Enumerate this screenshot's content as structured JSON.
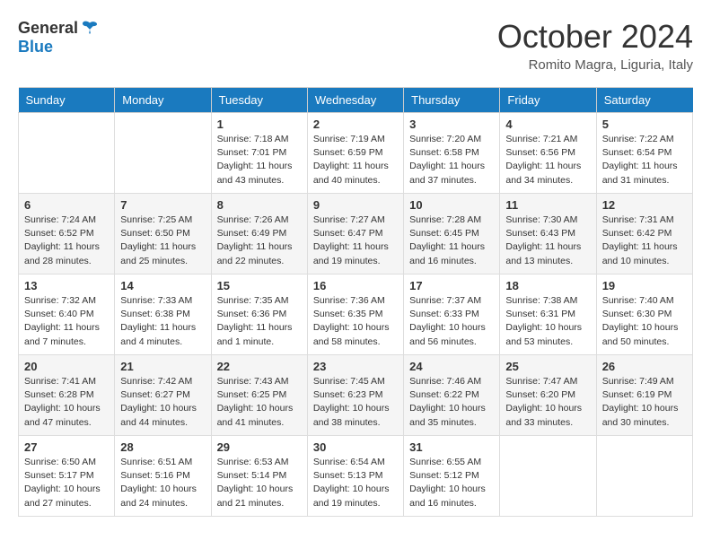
{
  "header": {
    "logo_general": "General",
    "logo_blue": "Blue",
    "month": "October 2024",
    "location": "Romito Magra, Liguria, Italy"
  },
  "days_of_week": [
    "Sunday",
    "Monday",
    "Tuesday",
    "Wednesday",
    "Thursday",
    "Friday",
    "Saturday"
  ],
  "weeks": [
    [
      {
        "day": "",
        "details": ""
      },
      {
        "day": "",
        "details": ""
      },
      {
        "day": "1",
        "details": "Sunrise: 7:18 AM\nSunset: 7:01 PM\nDaylight: 11 hours and 43 minutes."
      },
      {
        "day": "2",
        "details": "Sunrise: 7:19 AM\nSunset: 6:59 PM\nDaylight: 11 hours and 40 minutes."
      },
      {
        "day": "3",
        "details": "Sunrise: 7:20 AM\nSunset: 6:58 PM\nDaylight: 11 hours and 37 minutes."
      },
      {
        "day": "4",
        "details": "Sunrise: 7:21 AM\nSunset: 6:56 PM\nDaylight: 11 hours and 34 minutes."
      },
      {
        "day": "5",
        "details": "Sunrise: 7:22 AM\nSunset: 6:54 PM\nDaylight: 11 hours and 31 minutes."
      }
    ],
    [
      {
        "day": "6",
        "details": "Sunrise: 7:24 AM\nSunset: 6:52 PM\nDaylight: 11 hours and 28 minutes."
      },
      {
        "day": "7",
        "details": "Sunrise: 7:25 AM\nSunset: 6:50 PM\nDaylight: 11 hours and 25 minutes."
      },
      {
        "day": "8",
        "details": "Sunrise: 7:26 AM\nSunset: 6:49 PM\nDaylight: 11 hours and 22 minutes."
      },
      {
        "day": "9",
        "details": "Sunrise: 7:27 AM\nSunset: 6:47 PM\nDaylight: 11 hours and 19 minutes."
      },
      {
        "day": "10",
        "details": "Sunrise: 7:28 AM\nSunset: 6:45 PM\nDaylight: 11 hours and 16 minutes."
      },
      {
        "day": "11",
        "details": "Sunrise: 7:30 AM\nSunset: 6:43 PM\nDaylight: 11 hours and 13 minutes."
      },
      {
        "day": "12",
        "details": "Sunrise: 7:31 AM\nSunset: 6:42 PM\nDaylight: 11 hours and 10 minutes."
      }
    ],
    [
      {
        "day": "13",
        "details": "Sunrise: 7:32 AM\nSunset: 6:40 PM\nDaylight: 11 hours and 7 minutes."
      },
      {
        "day": "14",
        "details": "Sunrise: 7:33 AM\nSunset: 6:38 PM\nDaylight: 11 hours and 4 minutes."
      },
      {
        "day": "15",
        "details": "Sunrise: 7:35 AM\nSunset: 6:36 PM\nDaylight: 11 hours and 1 minute."
      },
      {
        "day": "16",
        "details": "Sunrise: 7:36 AM\nSunset: 6:35 PM\nDaylight: 10 hours and 58 minutes."
      },
      {
        "day": "17",
        "details": "Sunrise: 7:37 AM\nSunset: 6:33 PM\nDaylight: 10 hours and 56 minutes."
      },
      {
        "day": "18",
        "details": "Sunrise: 7:38 AM\nSunset: 6:31 PM\nDaylight: 10 hours and 53 minutes."
      },
      {
        "day": "19",
        "details": "Sunrise: 7:40 AM\nSunset: 6:30 PM\nDaylight: 10 hours and 50 minutes."
      }
    ],
    [
      {
        "day": "20",
        "details": "Sunrise: 7:41 AM\nSunset: 6:28 PM\nDaylight: 10 hours and 47 minutes."
      },
      {
        "day": "21",
        "details": "Sunrise: 7:42 AM\nSunset: 6:27 PM\nDaylight: 10 hours and 44 minutes."
      },
      {
        "day": "22",
        "details": "Sunrise: 7:43 AM\nSunset: 6:25 PM\nDaylight: 10 hours and 41 minutes."
      },
      {
        "day": "23",
        "details": "Sunrise: 7:45 AM\nSunset: 6:23 PM\nDaylight: 10 hours and 38 minutes."
      },
      {
        "day": "24",
        "details": "Sunrise: 7:46 AM\nSunset: 6:22 PM\nDaylight: 10 hours and 35 minutes."
      },
      {
        "day": "25",
        "details": "Sunrise: 7:47 AM\nSunset: 6:20 PM\nDaylight: 10 hours and 33 minutes."
      },
      {
        "day": "26",
        "details": "Sunrise: 7:49 AM\nSunset: 6:19 PM\nDaylight: 10 hours and 30 minutes."
      }
    ],
    [
      {
        "day": "27",
        "details": "Sunrise: 6:50 AM\nSunset: 5:17 PM\nDaylight: 10 hours and 27 minutes."
      },
      {
        "day": "28",
        "details": "Sunrise: 6:51 AM\nSunset: 5:16 PM\nDaylight: 10 hours and 24 minutes."
      },
      {
        "day": "29",
        "details": "Sunrise: 6:53 AM\nSunset: 5:14 PM\nDaylight: 10 hours and 21 minutes."
      },
      {
        "day": "30",
        "details": "Sunrise: 6:54 AM\nSunset: 5:13 PM\nDaylight: 10 hours and 19 minutes."
      },
      {
        "day": "31",
        "details": "Sunrise: 6:55 AM\nSunset: 5:12 PM\nDaylight: 10 hours and 16 minutes."
      },
      {
        "day": "",
        "details": ""
      },
      {
        "day": "",
        "details": ""
      }
    ]
  ]
}
